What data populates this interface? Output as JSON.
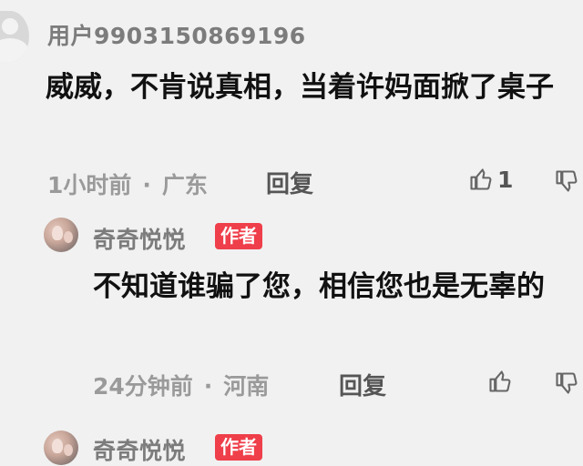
{
  "comments": [
    {
      "username": "用户9903150869196",
      "author_badge": "",
      "content": "威威，不肯说真相，当着许妈面掀了桌子",
      "time": "1小时前",
      "location": "广东",
      "reply_label": "回复",
      "like_count": "1"
    },
    {
      "username": "奇奇悦悦",
      "author_badge": "作者",
      "content": "不知道谁骗了您，相信您也是无辜的",
      "time": "24分钟前",
      "location": "河南",
      "reply_label": "回复",
      "like_count": ""
    },
    {
      "username": "奇奇悦悦",
      "author_badge": "作者"
    }
  ],
  "separator": "·",
  "icons": {
    "avatar_default": "default-user-avatar",
    "avatar_photo": "profile-photo-avatar",
    "like": "thumbs-up-icon",
    "dislike": "thumbs-down-icon"
  },
  "colors": {
    "background": "#f1f1f1",
    "author_badge": "#ef3f4a",
    "username": "#7c7c7c",
    "meta": "#9a9a9a"
  }
}
